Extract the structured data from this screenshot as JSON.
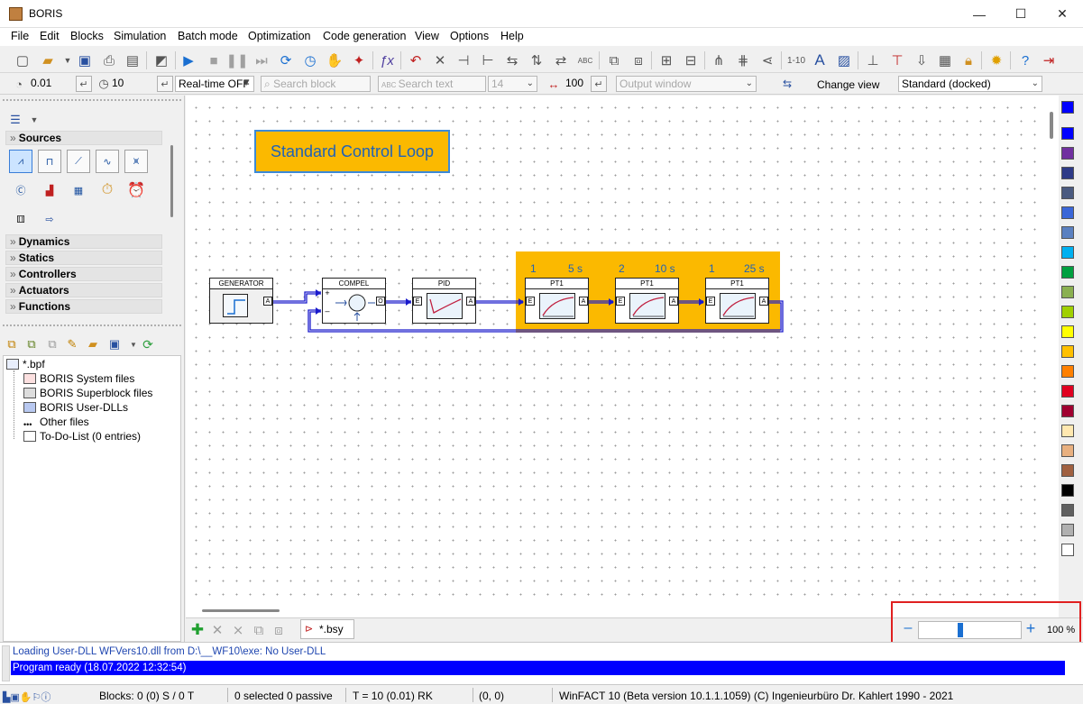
{
  "window": {
    "title": "BORIS"
  },
  "menu": [
    "File",
    "Edit",
    "Blocks",
    "Simulation",
    "Batch mode",
    "Optimization",
    "Code generation",
    "View",
    "Options",
    "Help"
  ],
  "toolbar2": {
    "step_size": "0.01",
    "sim_time": "10",
    "realtime": "Real-time OFF",
    "search_block_placeholder": "Search block",
    "search_text_placeholder": "Search text",
    "font_size": "14",
    "value_100": "100",
    "output_window": "Output window",
    "change_view": "Change view",
    "view_mode": "Standard (docked)"
  },
  "library": {
    "categories": [
      "Sources",
      "Dynamics",
      "Statics",
      "Controllers",
      "Actuators",
      "Functions"
    ]
  },
  "project_tree": {
    "root": "*.bpf",
    "items": [
      "BORIS System files",
      "BORIS Superblock files",
      "BORIS User-DLLs",
      "Other files",
      "To-Do-List (0 entries)"
    ]
  },
  "canvas": {
    "title_box": "Standard Control Loop",
    "blocks": {
      "generator": "GENERATOR",
      "compel": "COMPEL",
      "pid": "PID",
      "pt1a": "PT1",
      "pt1b": "PT1",
      "pt1c": "PT1"
    },
    "params": {
      "pt1a_k": "1",
      "pt1a_t": "5 s",
      "pt1b_k": "2",
      "pt1b_t": "10 s",
      "pt1c_k": "1",
      "pt1c_t": "25 s"
    },
    "ports": {
      "out": "A",
      "in": "E",
      "compel_out": "O",
      "plus": "+",
      "minus": "–"
    }
  },
  "tabs": {
    "doc": "*.bsy"
  },
  "zoom": {
    "minus": "–",
    "plus": "+",
    "level": "100 %",
    "value_percent": 40
  },
  "log": {
    "line1": "Loading User-DLL WFVers10.dll from D:\\__WF10\\exe: No User-DLL",
    "line2": "Program ready    (18.07.2022 12:32:54)"
  },
  "status": {
    "blocks": "Blocks: 0 (0) S / 0 T",
    "selected": "0 selected  0 passive",
    "time": "T = 10  (0.01)  RK",
    "coords": "(0, 0)",
    "version": "WinFACT 10 (Beta version 10.1.1.1059)  (C) Ingenieurbüro Dr. Kahlert 1990 - 2021"
  },
  "palette_colors": [
    "#0000ff",
    "#0000ff",
    "#7030a0",
    "#2e3a87",
    "#4a5a80",
    "#3a66d8",
    "#5a80c0",
    "#00b0f0",
    "#00a040",
    "#8ab050",
    "#a0d000",
    "#ffff00",
    "#ffc000",
    "#ff8000",
    "#e00020",
    "#a00030",
    "#ffe8b0",
    "#e8b080",
    "#a06040",
    "#000000",
    "#606060",
    "#b0b0b0",
    "#ffffff"
  ]
}
